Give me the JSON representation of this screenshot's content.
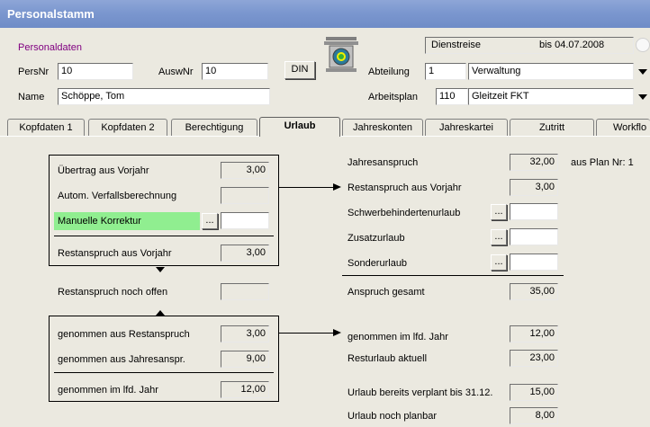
{
  "window": {
    "title": "Personalstamm"
  },
  "header": {
    "section_label": "Personaldaten",
    "persnr_label": "PersNr",
    "persnr_value": "10",
    "auswnr_label": "AuswNr",
    "auswnr_value": "10",
    "din_button": "DIN",
    "name_label": "Name",
    "name_value": "Schöppe, Tom",
    "status_text": "Dienstreise",
    "status_until": "bis 04.07.2008",
    "abteilung_label": "Abteilung",
    "abteilung_nr": "1",
    "abteilung_name": "Verwaltung",
    "arbeitsplan_label": "Arbeitsplan",
    "arbeitsplan_nr": "110",
    "arbeitsplan_name": "Gleitzeit FKT"
  },
  "tabs": [
    {
      "label": "Kopfdaten 1"
    },
    {
      "label": "Kopfdaten 2"
    },
    {
      "label": "Berechtigung"
    },
    {
      "label": "Urlaub"
    },
    {
      "label": "Jahreskonten"
    },
    {
      "label": "Jahreskartei"
    },
    {
      "label": "Zutritt"
    },
    {
      "label": "Workflo"
    }
  ],
  "left": {
    "uebertrag_label": "Übertrag aus Vorjahr",
    "uebertrag_value": "3,00",
    "verfall_label": "Autom. Verfallsberechnung",
    "verfall_value": "",
    "korrektur_label": "Manuelle Korrektur",
    "korrektur_value": "",
    "restanspruch_vj_label": "Restanspruch aus Vorjahr",
    "restanspruch_vj_value": "3,00",
    "noch_offen_label": "Restanspruch noch offen",
    "noch_offen_value": "",
    "genommen_rest_label": "genommen aus Restanspruch",
    "genommen_rest_value": "3,00",
    "genommen_jahr_label": "genommen aus Jahresanspr.",
    "genommen_jahr_value": "9,00",
    "genommen_lfd_label": "genommen im lfd. Jahr",
    "genommen_lfd_value": "12,00"
  },
  "right": {
    "jahresanspruch_label": "Jahresanspruch",
    "jahresanspruch_value": "32,00",
    "aus_plan_label": "aus Plan Nr: 1",
    "restanspruch_label": "Restanspruch aus Vorjahr",
    "restanspruch_value": "3,00",
    "schwerbehinderten_label": "Schwerbehindertenurlaub",
    "zusatz_label": "Zusatzurlaub",
    "sonder_label": "Sonderurlaub",
    "anspruch_gesamt_label": "Anspruch gesamt",
    "anspruch_gesamt_value": "35,00",
    "genommen_lfd_label": "genommen im lfd. Jahr",
    "genommen_lfd_value": "12,00",
    "resturlaub_label": "Resturlaub aktuell",
    "resturlaub_value": "23,00",
    "verplant_label": "Urlaub bereits verplant bis 31.12.",
    "verplant_value": "15,00",
    "planbar_label": "Urlaub noch planbar",
    "planbar_value": "8,00"
  },
  "ellipsis": "...",
  "colors": {
    "title_bar": "#7b97cf",
    "highlight": "#90ee90",
    "section_label": "#800080"
  }
}
